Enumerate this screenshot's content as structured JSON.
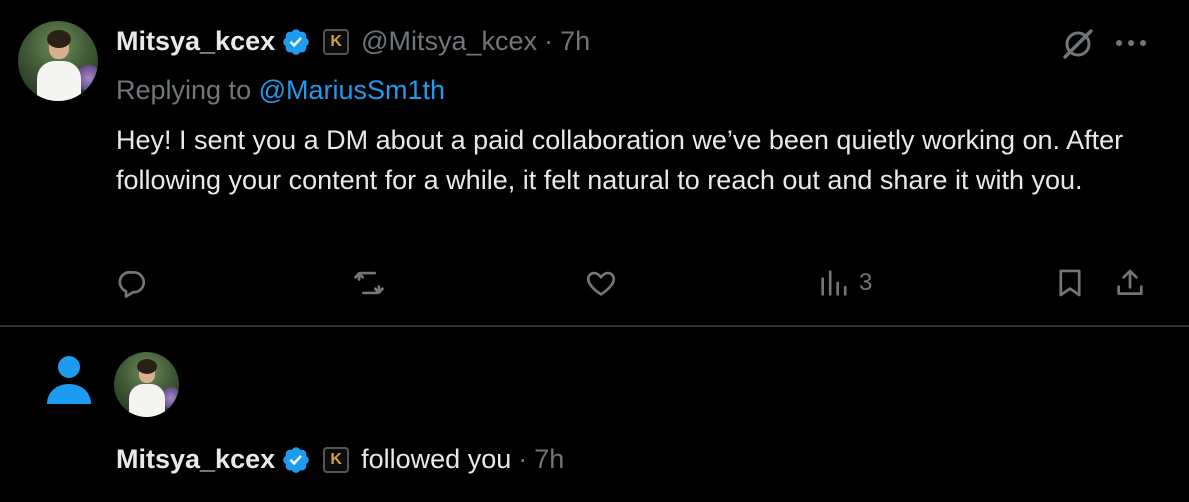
{
  "tweet": {
    "display_name": "Mitsya_kcex",
    "badge_letter": "K",
    "handle": "@Mitsya_kcex",
    "separator": "·",
    "time": "7h",
    "reply_prefix": "Replying to",
    "reply_handle": "@MariusSm1th",
    "text": "Hey! I sent you a DM about a paid collaboration we’ve been quietly working on. After following your content for a while, it felt natural to reach out and share it with you.",
    "actions": {
      "reply_icon": "reply-icon",
      "repost_icon": "repost-icon",
      "like_icon": "heart-icon",
      "views_icon": "views-icon",
      "views_count": "3",
      "bookmark_icon": "bookmark-icon",
      "share_icon": "share-icon"
    },
    "header_icons": [
      "grok-icon",
      "more-icon"
    ]
  },
  "notification": {
    "type_icon": "person-icon",
    "display_name": "Mitsya_kcex",
    "badge_letter": "K",
    "action_text": "followed you",
    "separator": "·",
    "time": "7h"
  },
  "colors": {
    "background": "#000000",
    "text_primary": "#e7e9ea",
    "text_secondary": "#71767b",
    "link_blue": "#1d9bf0",
    "verified_blue": "#1d9bf0",
    "divider": "#2f3336",
    "badge_gold": "#d4a03a"
  }
}
